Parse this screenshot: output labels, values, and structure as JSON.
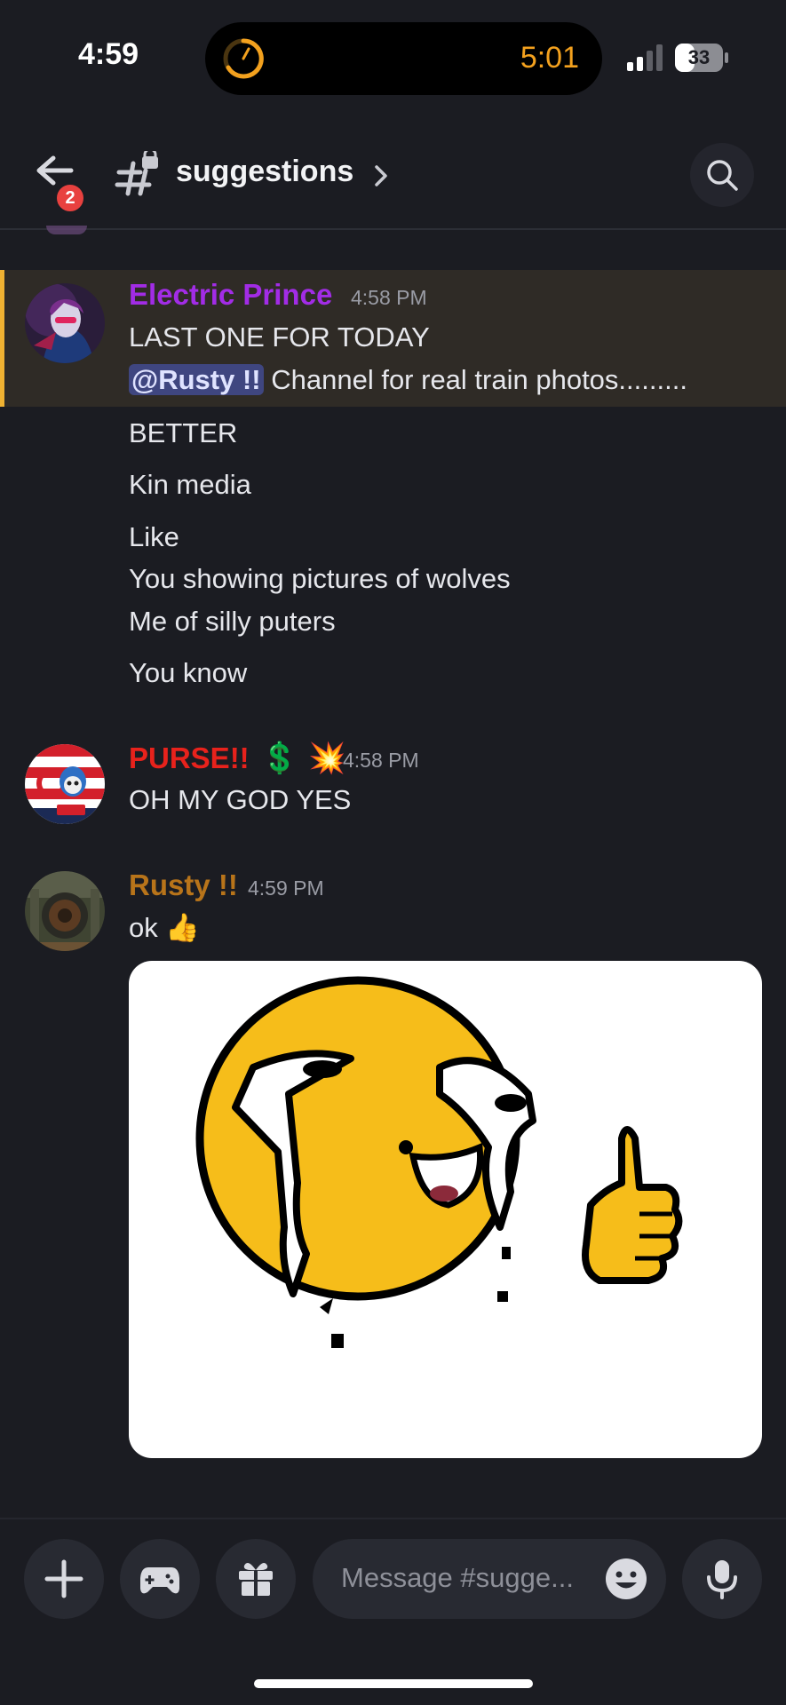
{
  "status_bar": {
    "time": "4:59",
    "live_activity_timer": "5:01",
    "battery_level": "33"
  },
  "header": {
    "notification_count": "2",
    "channel_name": "suggestions"
  },
  "messages": [
    {
      "author": "Electric Prince",
      "author_color": "#a22ce6",
      "timestamp": "4:58 PM",
      "highlighted": true,
      "lines": [
        "LAST ONE FOR TODAY",
        {
          "mention": "@Rusty !!",
          "text": " Channel for real train photos........."
        },
        "BETTER",
        "Kin media",
        "Like",
        "You showing pictures of wolves",
        "Me of silly puters",
        "You know"
      ]
    },
    {
      "author": "PURSE!!",
      "author_color": "#e8221c",
      "author_emojis": [
        "💲",
        "💥"
      ],
      "timestamp": "4:58 PM",
      "lines": [
        "OH MY GOD YES"
      ]
    },
    {
      "author": "Rusty !!",
      "author_color": "#b8741a",
      "timestamp": "4:59 PM",
      "lines": [
        "ok 👍"
      ],
      "sticker": "crying-thumbs-up-smiley"
    }
  ],
  "composer": {
    "placeholder": "Message #sugge..."
  },
  "icons": {
    "back": "arrow-left-icon",
    "channel": "hashtag-lock-icon",
    "search": "search-icon",
    "add": "plus-icon",
    "games": "gamepad-icon",
    "gift": "gift-icon",
    "emoji": "smiley-icon",
    "voice": "microphone-icon"
  }
}
